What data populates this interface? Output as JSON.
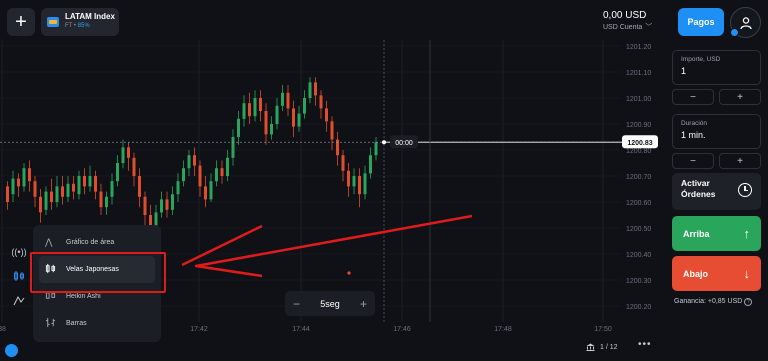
{
  "topbar": {
    "add_label": "+",
    "asset": {
      "name": "LATAM Index",
      "type": "FT",
      "payout": "85%"
    },
    "balance": {
      "amount": "0,00 USD",
      "account": "USD Cuenta"
    },
    "pagos_label": "Pagos"
  },
  "chart_data": {
    "type": "candlestick",
    "y_ticks": [
      "1201.20",
      "1201.10",
      "1201.00",
      "1200.90",
      "1200.80",
      "1200.70",
      "1200.60",
      "1200.50",
      "1200.40",
      "1200.30",
      "1200.20"
    ],
    "x_ticks": [
      "38",
      "17:42",
      "17:44",
      "17:46",
      "17:48",
      "17:50"
    ],
    "current_price": "1200.83",
    "countdown": "00:00",
    "colors": {
      "up": "#2aa55c",
      "down": "#e04e2e"
    }
  },
  "left_tools": [
    "signal-icon",
    "candles-icon",
    "area-icon"
  ],
  "chart_type_menu": {
    "items": [
      {
        "label": "Gráfico de área",
        "icon": "area-chart-icon",
        "active": false
      },
      {
        "label": "Velas Japonesas",
        "icon": "candles-icon",
        "active": true
      },
      {
        "label": "Heikin Ashi",
        "icon": "heikin-ashi-icon",
        "active": false
      },
      {
        "label": "Barras",
        "icon": "bars-icon",
        "active": false
      }
    ]
  },
  "timeframe": {
    "minus": "−",
    "value": "5seg",
    "plus": "+"
  },
  "bottom": {
    "pages": "1 / 12",
    "more": "•••"
  },
  "trade_panel": {
    "amount": {
      "label": "Importe, USD",
      "value": "1"
    },
    "duration": {
      "label": "Duración",
      "value": "1 min."
    },
    "stepper_minus": "−",
    "stepper_plus": "+",
    "activar_label": "Activar Órdenes",
    "arriba_label": "Arriba",
    "abajo_label": "Abajo",
    "ganancia": "Ganancia: +0,85 USD"
  }
}
